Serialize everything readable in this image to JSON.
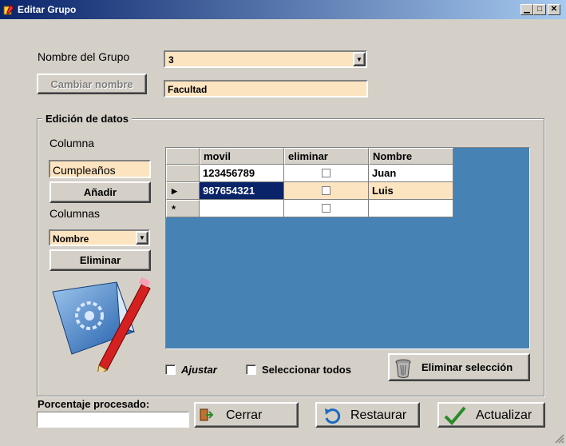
{
  "window": {
    "title": "Editar Grupo"
  },
  "group": {
    "name_label": "Nombre del Grupo",
    "name_value": "3",
    "rename_button": "Cambiar nombre",
    "rename_value": "Facultad"
  },
  "edit": {
    "legend": "Edición de datos",
    "column_label": "Columna",
    "column_value": "Cumpleaños",
    "add_button": "Añadir",
    "columns_label": "Columnas",
    "columns_value": "Nombre",
    "remove_button": "Eliminar"
  },
  "grid": {
    "headers": [
      "movil",
      "eliminar",
      "Nombre"
    ],
    "rows": [
      {
        "movil": "123456789",
        "nombre": "Juan",
        "marker": ""
      },
      {
        "movil": "987654321",
        "nombre": "Luis",
        "marker": "▶"
      },
      {
        "movil": "",
        "nombre": "",
        "marker": "*"
      }
    ]
  },
  "options": {
    "ajustar_label": "Ajustar",
    "select_all_label": "Seleccionar todos",
    "delete_selection_button": "Eliminar selección"
  },
  "footer": {
    "progress_label": "Porcentaje procesado:",
    "progress": 0,
    "close_button": "Cerrar",
    "restore_button": "Restaurar",
    "update_button": "Actualizar"
  },
  "colors": {
    "title_start": "#0a246a",
    "title_end": "#a6caf0",
    "field_bg": "#fce4c0",
    "grid_bg": "#4682b4",
    "selection": "#0a246a"
  }
}
